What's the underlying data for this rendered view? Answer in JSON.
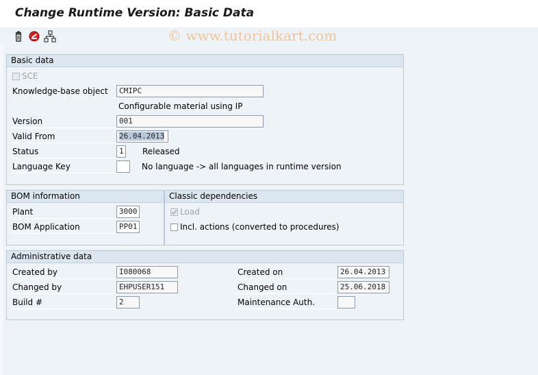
{
  "title": "Change Runtime Version: Basic Data",
  "watermark": "© www.tutorialkart.com",
  "toolbar": {
    "icons": [
      "delete-icon",
      "display-change-icon",
      "hierarchy-icon"
    ]
  },
  "basic_data": {
    "header": "Basic data",
    "sce_label": "SCE",
    "kb_object_label": "Knowledge-base object",
    "kb_object_value": "CMIPC",
    "kb_object_desc": "Configurable material using IP",
    "version_label": "Version",
    "version_value": "001",
    "valid_from_label": "Valid From",
    "valid_from_value": "26.04.2013",
    "status_label": "Status",
    "status_value": "1",
    "status_text": "Released",
    "language_label": "Language Key",
    "language_value": "",
    "language_text": "No language -> all languages in runtime version"
  },
  "bom_info": {
    "header": "BOM information",
    "plant_label": "Plant",
    "plant_value": "3000",
    "bom_app_label": "BOM Application",
    "bom_app_value": "PP01"
  },
  "classic_dependencies": {
    "header": "Classic dependencies",
    "load_label": "Load",
    "load_checked": true,
    "incl_actions_label": "Incl. actions (converted to procedures)",
    "incl_actions_checked": false
  },
  "admin_data": {
    "header": "Administrative data",
    "created_by_label": "Created by",
    "created_by_value": "I080068",
    "changed_by_label": "Changed by",
    "changed_by_value": "EHPUSER151",
    "build_label": "Build #",
    "build_value": "2",
    "created_on_label": "Created on",
    "created_on_value": "26.04.2013",
    "changed_on_label": "Changed on",
    "changed_on_value": "25.06.2018",
    "maint_auth_label": "Maintenance Auth.",
    "maint_auth_value": ""
  }
}
